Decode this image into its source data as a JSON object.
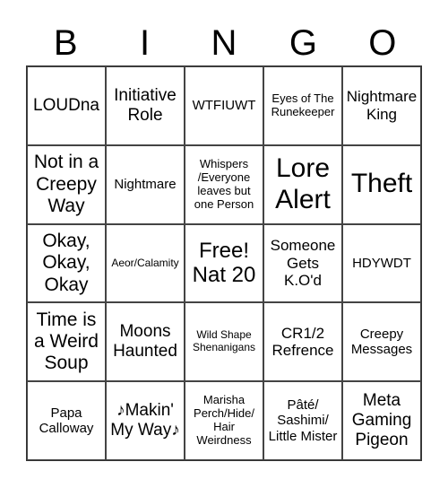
{
  "title_letters": [
    "B",
    "I",
    "N",
    "G",
    "O"
  ],
  "rows": [
    [
      "LOUDna",
      "Initiative Role",
      "WTFIUWT",
      "Eyes of The Runekeeper",
      "Nightmare King"
    ],
    [
      "Not in a Creepy Way",
      "Nightmare",
      "Whispers /Everyone leaves but one Person",
      "Lore Alert",
      "Theft"
    ],
    [
      "Okay, Okay, Okay",
      "Aeor/Calamity",
      "Free! Nat 20",
      "Someone Gets K.O'd",
      "HDYWDT"
    ],
    [
      "Time is a Weird Soup",
      "Moons Haunted",
      "Wild Shape Shenanigans",
      "CR1/2 Refrence",
      "Creepy Messages"
    ],
    [
      "Papa Calloway",
      "♪Makin' My Way♪",
      "Marisha Perch/Hide/ Hair Weirdness",
      "Pâté/ Sashimi/ Little Mister",
      "Meta Gaming Pigeon"
    ]
  ]
}
